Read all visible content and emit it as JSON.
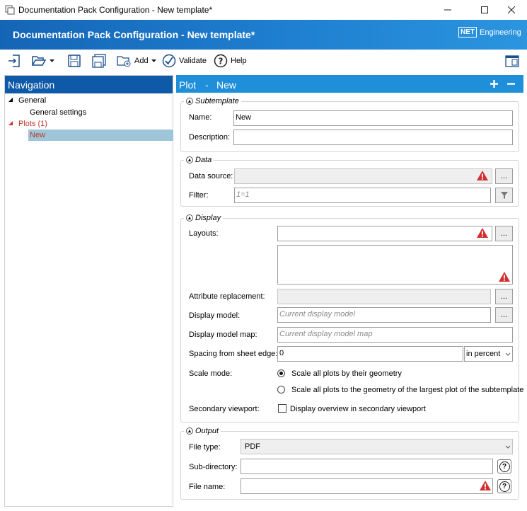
{
  "window": {
    "title": "Documentation Pack Configuration - New template*"
  },
  "header": {
    "title": "Documentation Pack Configuration - New template*",
    "logo_box": "NET",
    "logo_text": "Engineering"
  },
  "toolbar": {
    "add_label": "Add",
    "validate_label": "Validate",
    "help_label": "Help"
  },
  "navigation": {
    "title": "Navigation",
    "items": [
      {
        "label": "General"
      },
      {
        "label": "General settings"
      },
      {
        "label": "Plots (1)"
      },
      {
        "label": "New"
      }
    ]
  },
  "plot_panel": {
    "title": "Plot",
    "separator": "-",
    "name": "New"
  },
  "subtemplate": {
    "title": "Subtemplate",
    "name_label": "Name:",
    "name_value": "New",
    "description_label": "Description:",
    "description_value": ""
  },
  "data": {
    "title": "Data",
    "data_source_label": "Data source:",
    "data_source_value": "",
    "filter_label": "Filter:",
    "filter_placeholder": "1=1"
  },
  "display": {
    "title": "Display",
    "layouts_label": "Layouts:",
    "attribute_replacement_label": "Attribute replacement:",
    "display_model_label": "Display model:",
    "display_model_placeholder": "Current display model",
    "display_model_map_label": "Display model map:",
    "display_model_map_placeholder": "Current display model map",
    "spacing_label": "Spacing from sheet edge:",
    "spacing_value": "0",
    "spacing_unit": "in percent",
    "scale_mode_label": "Scale mode:",
    "scale_option_1": "Scale all plots by their geometry",
    "scale_option_2": "Scale all plots to the geometry of the largest plot of the subtemplate",
    "secondary_viewport_label": "Secondary viewport:",
    "secondary_viewport_checkbox": "Display overview in secondary viewport"
  },
  "output": {
    "title": "Output",
    "file_type_label": "File type:",
    "file_type_value": "PDF",
    "sub_directory_label": "Sub-directory:",
    "sub_directory_value": "",
    "file_name_label": "File name:",
    "file_name_value": ""
  },
  "colors": {
    "header_blue": "#1565b6",
    "nav_header": "#0f5aa8",
    "plot_header": "#1e8fd8",
    "plots_red": "#c0392b",
    "selection": "#9ec5d8",
    "warning_red": "#d32f2f"
  }
}
